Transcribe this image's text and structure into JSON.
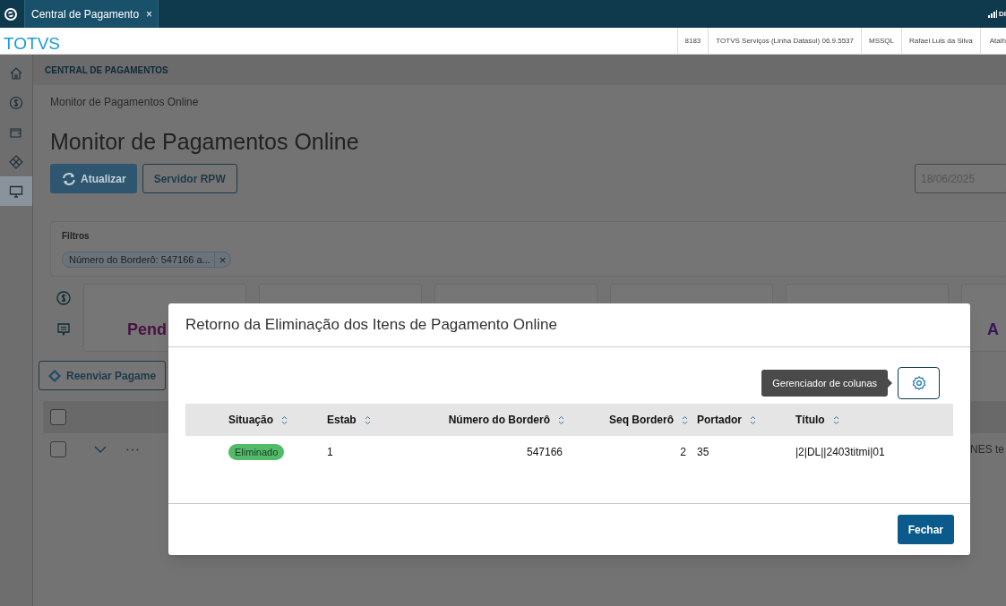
{
  "top_bar": {
    "tab": {
      "label": "Central de Pagamento",
      "close": "×"
    },
    "status": "DI"
  },
  "header": {
    "brand": "TOTVS",
    "info": [
      "8183",
      "TOTVS Serviços (Linha Datasul) 06.9.5537",
      "MSSQL",
      "Rafael Luis da Silva",
      "Atalh"
    ]
  },
  "sidebar": {
    "items": [
      {
        "kind": "home",
        "selected": false
      },
      {
        "kind": "dollar",
        "selected": false
      },
      {
        "kind": "wallet",
        "selected": false
      },
      {
        "kind": "diamond",
        "selected": false
      },
      {
        "kind": "monitor",
        "selected": true
      }
    ]
  },
  "section_title": "CENTRAL DE PAGAMENTOS",
  "page": {
    "breadcrumb": "Monitor de Pagamentos Online",
    "title": "Monitor de Pagamentos Online",
    "buttons": [
      {
        "label": "Atualizar",
        "kind": "primary"
      },
      {
        "label": "Servidor RPW",
        "kind": "secondary"
      }
    ],
    "date": "18/06/2025"
  },
  "filters": {
    "label": "Filtros",
    "chips": [
      {
        "text": "Número do Borderô: 547166 a...",
        "remove": "×"
      }
    ]
  },
  "summary_cards": [
    {
      "kind": "label",
      "label": "Pend",
      "color": "#4a1040"
    },
    {
      "kind": "empty"
    },
    {
      "kind": "empty"
    },
    {
      "kind": "empty"
    },
    {
      "kind": "empty"
    },
    {
      "kind": "label",
      "label": "A",
      "color": "#36145a"
    }
  ],
  "actions": {
    "resend_button": "Reenviar Pagame"
  },
  "table": {
    "header_checked": false,
    "rows": [
      {
        "checked": false,
        "trailing_text": "NES te"
      }
    ]
  },
  "modal": {
    "title": "Retorno da Eliminação dos Itens de Pagamento Online",
    "tooltip": "Gerenciador de colunas",
    "columns": [
      {
        "label": "Situação",
        "kind": "text"
      },
      {
        "label": "Estab",
        "kind": "text"
      },
      {
        "label": "Número do Borderô",
        "kind": "number"
      },
      {
        "label": "Seq Borderô",
        "kind": "number"
      },
      {
        "label": "Portador",
        "kind": "text"
      },
      {
        "label": "Título",
        "kind": "text"
      }
    ],
    "rows": [
      {
        "cells": [
          {
            "kind": "tag",
            "text": "Eliminado",
            "color": "#52bb6a"
          },
          {
            "kind": "text",
            "text": "1"
          },
          {
            "kind": "text",
            "text": "547166"
          },
          {
            "kind": "text",
            "text": "2"
          },
          {
            "kind": "text",
            "text": "35"
          },
          {
            "kind": "text",
            "text": "|2|DL||2403titmi|01"
          }
        ]
      }
    ],
    "close_button": "Fechar"
  }
}
